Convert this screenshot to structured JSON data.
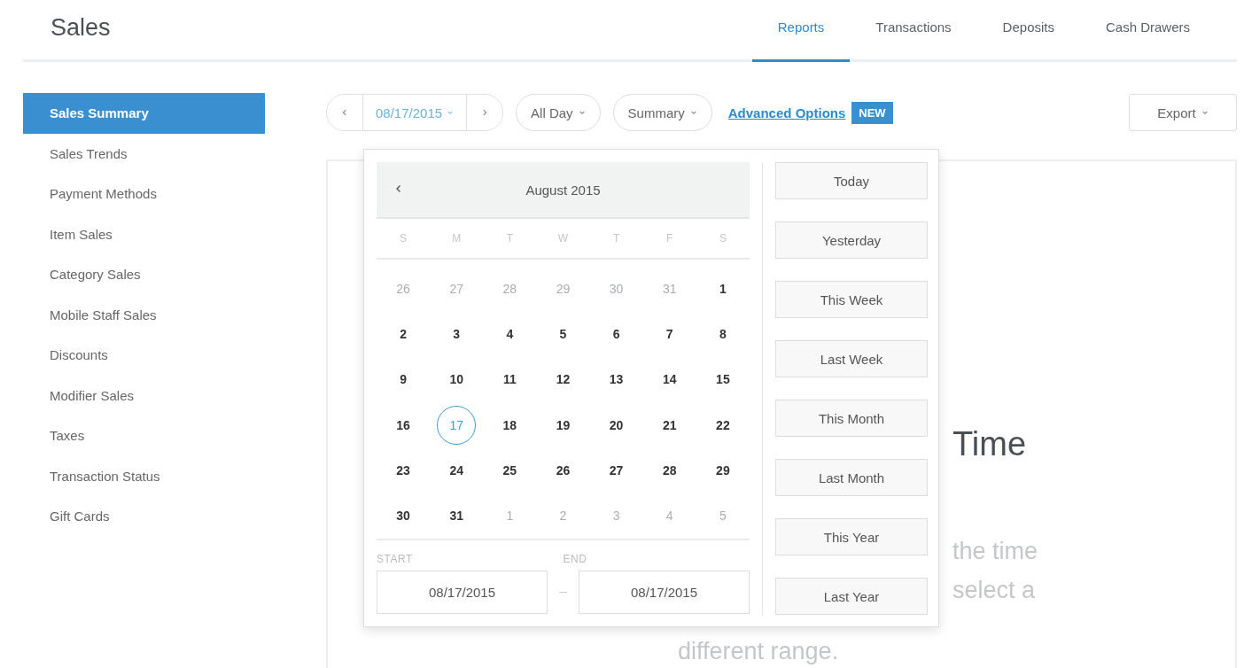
{
  "header": {
    "title": "Sales",
    "tabs": [
      {
        "label": "Reports",
        "selected": true
      },
      {
        "label": "Transactions",
        "selected": false
      },
      {
        "label": "Deposits",
        "selected": false
      },
      {
        "label": "Cash Drawers",
        "selected": false
      }
    ]
  },
  "sidebar": {
    "items": [
      {
        "label": "Sales Summary",
        "selected": true
      },
      {
        "label": "Sales Trends",
        "selected": false
      },
      {
        "label": "Payment Methods",
        "selected": false
      },
      {
        "label": "Item Sales",
        "selected": false
      },
      {
        "label": "Category Sales",
        "selected": false
      },
      {
        "label": "Mobile Staff Sales",
        "selected": false
      },
      {
        "label": "Discounts",
        "selected": false
      },
      {
        "label": "Modifier Sales",
        "selected": false
      },
      {
        "label": "Taxes",
        "selected": false
      },
      {
        "label": "Transaction Status",
        "selected": false
      },
      {
        "label": "Gift Cards",
        "selected": false
      }
    ]
  },
  "toolbar": {
    "date": "08/17/2015",
    "time_range": "All Day",
    "view": "Summary",
    "advanced_link": "Advanced Options",
    "badge": "NEW",
    "export": "Export"
  },
  "calendar": {
    "month": "August 2015",
    "weekdays": [
      "S",
      "M",
      "T",
      "W",
      "T",
      "F",
      "S"
    ],
    "weeks": [
      [
        {
          "label": "26",
          "muted": true,
          "selected": false
        },
        {
          "label": "27",
          "muted": true,
          "selected": false
        },
        {
          "label": "28",
          "muted": true,
          "selected": false
        },
        {
          "label": "29",
          "muted": true,
          "selected": false
        },
        {
          "label": "30",
          "muted": true,
          "selected": false
        },
        {
          "label": "31",
          "muted": true,
          "selected": false
        },
        {
          "label": "1",
          "muted": false,
          "selected": false
        }
      ],
      [
        {
          "label": "2",
          "muted": false,
          "selected": false
        },
        {
          "label": "3",
          "muted": false,
          "selected": false
        },
        {
          "label": "4",
          "muted": false,
          "selected": false
        },
        {
          "label": "5",
          "muted": false,
          "selected": false
        },
        {
          "label": "6",
          "muted": false,
          "selected": false
        },
        {
          "label": "7",
          "muted": false,
          "selected": false
        },
        {
          "label": "8",
          "muted": false,
          "selected": false
        }
      ],
      [
        {
          "label": "9",
          "muted": false,
          "selected": false
        },
        {
          "label": "10",
          "muted": false,
          "selected": false
        },
        {
          "label": "11",
          "muted": false,
          "selected": false
        },
        {
          "label": "12",
          "muted": false,
          "selected": false
        },
        {
          "label": "13",
          "muted": false,
          "selected": false
        },
        {
          "label": "14",
          "muted": false,
          "selected": false
        },
        {
          "label": "15",
          "muted": false,
          "selected": false
        }
      ],
      [
        {
          "label": "16",
          "muted": false,
          "selected": false
        },
        {
          "label": "17",
          "muted": false,
          "selected": true
        },
        {
          "label": "18",
          "muted": false,
          "selected": false
        },
        {
          "label": "19",
          "muted": false,
          "selected": false
        },
        {
          "label": "20",
          "muted": false,
          "selected": false
        },
        {
          "label": "21",
          "muted": false,
          "selected": false
        },
        {
          "label": "22",
          "muted": false,
          "selected": false
        }
      ],
      [
        {
          "label": "23",
          "muted": false,
          "selected": false
        },
        {
          "label": "24",
          "muted": false,
          "selected": false
        },
        {
          "label": "25",
          "muted": false,
          "selected": false
        },
        {
          "label": "26",
          "muted": false,
          "selected": false
        },
        {
          "label": "27",
          "muted": false,
          "selected": false
        },
        {
          "label": "28",
          "muted": false,
          "selected": false
        },
        {
          "label": "29",
          "muted": false,
          "selected": false
        }
      ],
      [
        {
          "label": "30",
          "muted": false,
          "selected": false
        },
        {
          "label": "31",
          "muted": false,
          "selected": false
        },
        {
          "label": "1",
          "muted": true,
          "selected": false
        },
        {
          "label": "2",
          "muted": true,
          "selected": false
        },
        {
          "label": "3",
          "muted": true,
          "selected": false
        },
        {
          "label": "4",
          "muted": true,
          "selected": false
        },
        {
          "label": "5",
          "muted": true,
          "selected": false
        }
      ]
    ],
    "start_label": "START",
    "end_label": "END",
    "start": "08/17/2015",
    "separator": "–",
    "end": "08/17/2015",
    "presets": [
      "Today",
      "Yesterday",
      "This Week",
      "Last Week",
      "This Month",
      "Last Month",
      "This Year",
      "Last Year"
    ]
  },
  "panel": {
    "heading": "Time",
    "lines": [
      "the time",
      "select a"
    ],
    "footer": "different range."
  }
}
